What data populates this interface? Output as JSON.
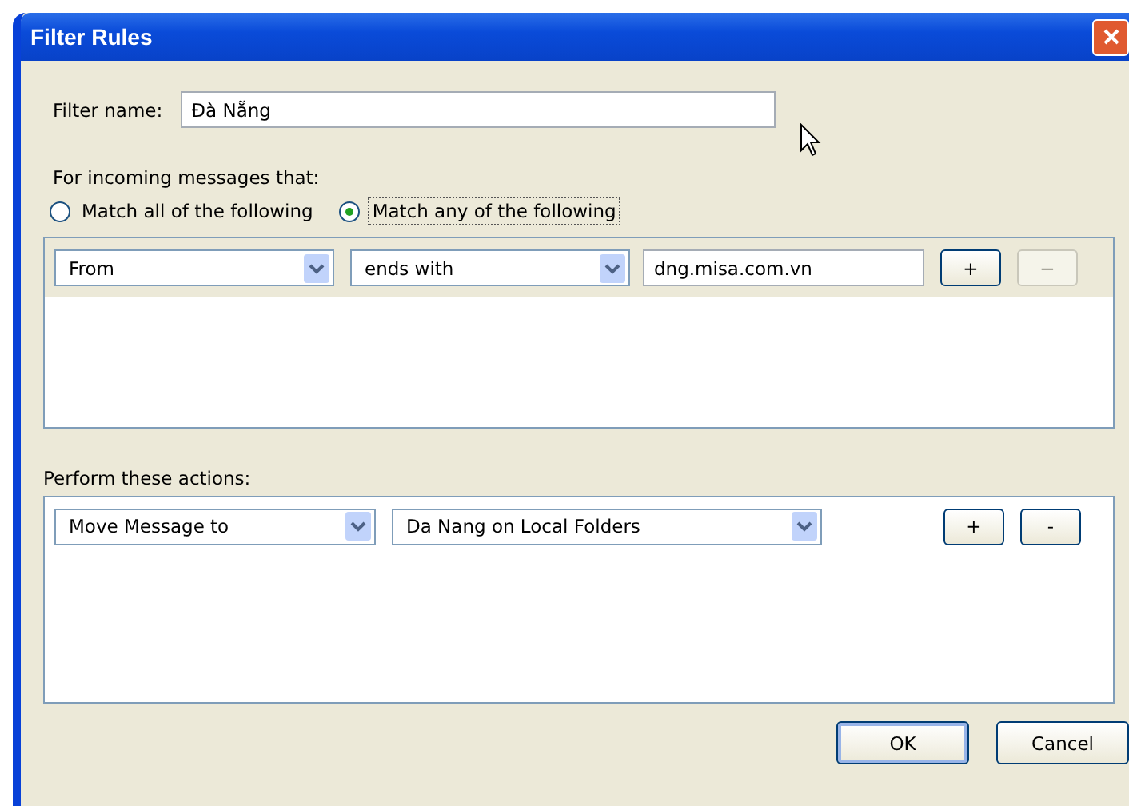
{
  "window": {
    "title": "Filter Rules"
  },
  "filter_name": {
    "label": "Filter name:",
    "value": "Đà Nẵng"
  },
  "conditions": {
    "label": "For incoming messages that:",
    "match_options": [
      {
        "label": "Match all of the following",
        "selected": false
      },
      {
        "label": "Match any of the following",
        "selected": true
      }
    ],
    "rules": [
      {
        "field": "From",
        "operator": "ends with",
        "value": "dng.misa.com.vn",
        "add": "+",
        "remove": "−",
        "remove_disabled": true
      }
    ]
  },
  "actions": {
    "label": "Perform these actions:",
    "rows": [
      {
        "action": "Move Message to",
        "target": "Da Nang on Local Folders",
        "add": "+",
        "remove": "-",
        "remove_disabled": false
      }
    ]
  },
  "buttons": [
    {
      "label": "OK",
      "default": true
    },
    {
      "label": "Cancel",
      "default": false
    }
  ]
}
